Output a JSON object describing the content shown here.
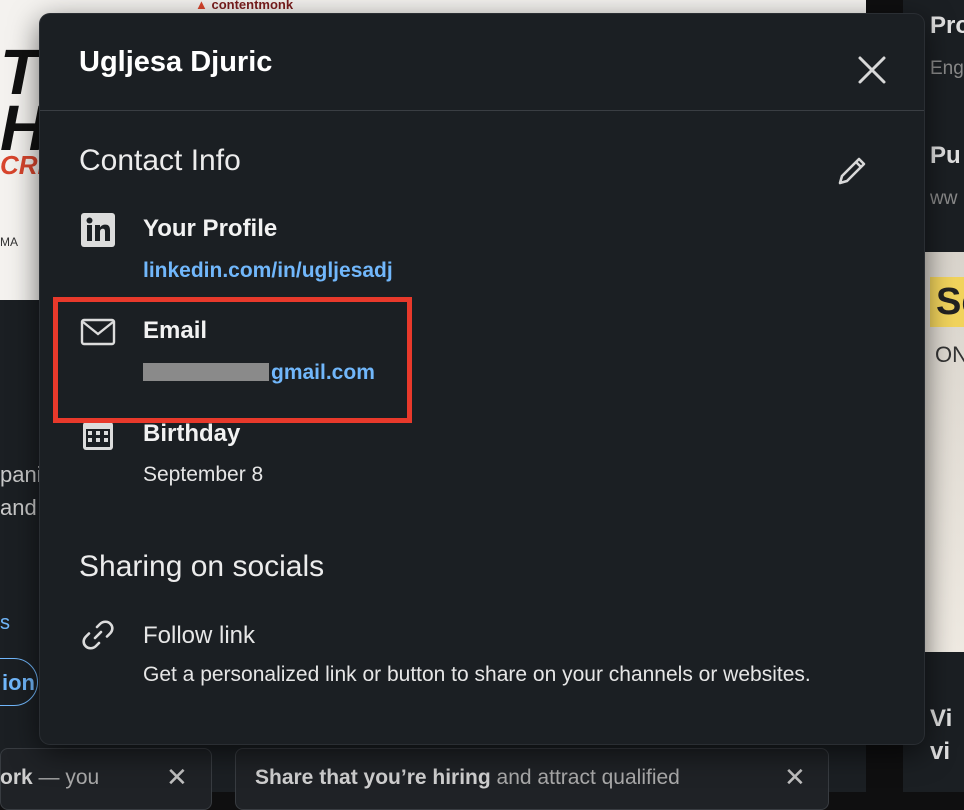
{
  "background": {
    "banner_brand": "contentmonk",
    "banner_big_lines": [
      "T",
      "H"
    ],
    "banner_red": "CRE",
    "banner_small": "MA",
    "left_text_lines": [
      "panic",
      "and"
    ],
    "left_link": "s",
    "left_button": "ion",
    "bottom_card_1": {
      "bold": "ork",
      "rest": " — you"
    },
    "bottom_card_2": {
      "bold": "Share that you’re hiring",
      "rest": " and attract qualified"
    },
    "right_column": {
      "title_1": "Pro",
      "sub_1": "Eng",
      "title_2": "Pu",
      "sub_2": "ww",
      "image_text": "Sc",
      "image_sub": "ON",
      "title_3a": "Vi",
      "title_3b": "vi"
    }
  },
  "modal": {
    "title": "Ugljesa Djuric",
    "contact_section_title": "Contact Info",
    "profile": {
      "label": "Your Profile",
      "value": "linkedin.com/in/ugljesadj"
    },
    "email": {
      "label": "Email",
      "value_visible": "gmail.com"
    },
    "birthday": {
      "label": "Birthday",
      "value": "September 8"
    },
    "sharing_section_title": "Sharing on socials",
    "follow_link": {
      "label": "Follow link",
      "description": "Get a personalized link or button to share on your channels or websites."
    }
  },
  "colors": {
    "modal_background": "#1b1f23",
    "link": "#71b7fb",
    "highlight": "#e8392b"
  },
  "icons": {
    "profile": "linkedin-icon",
    "email": "envelope-icon",
    "birthday": "calendar-icon",
    "follow": "link-icon",
    "close": "close-icon",
    "edit": "pencil-icon"
  }
}
